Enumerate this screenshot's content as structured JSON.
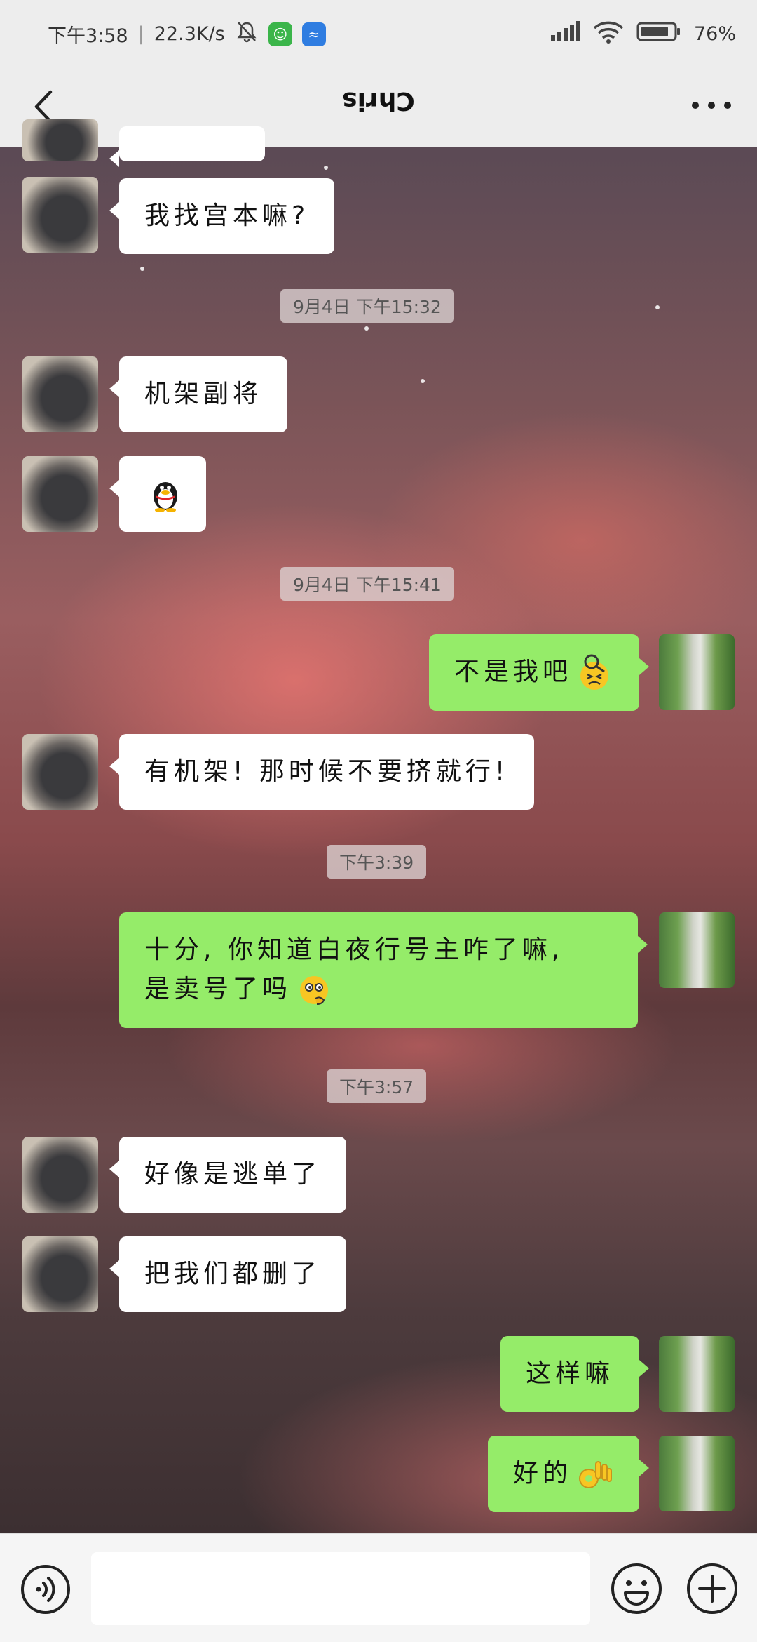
{
  "status_bar": {
    "time": "下午3:58",
    "speed": "22.3K/s",
    "battery": "76%"
  },
  "header": {
    "title": "Chris"
  },
  "messages": [
    {
      "side": "in",
      "text": "我找宫本嘛?"
    },
    {
      "type": "timestamp",
      "text": "9月4日 下午15:32"
    },
    {
      "side": "in",
      "text": "机架副将"
    },
    {
      "side": "in",
      "emoji": "qq-penguin-icon"
    },
    {
      "type": "timestamp",
      "text": "9月4日 下午15:41"
    },
    {
      "side": "out",
      "text": "不是我吧",
      "emoji": "embarrassed-emoji-icon"
    },
    {
      "side": "in",
      "text": "有机架! 那时候不要挤就行!"
    },
    {
      "type": "timestamp",
      "text": "下午3:39"
    },
    {
      "side": "out",
      "text": "十分, 你知道白夜行号主咋了嘛,",
      "text2": "是卖号了吗",
      "emoji": "thinking-emoji-icon"
    },
    {
      "type": "timestamp",
      "text": "下午3:57"
    },
    {
      "side": "in",
      "text": "好像是逃单了"
    },
    {
      "side": "in",
      "text": "把我们都删了"
    },
    {
      "side": "out",
      "text": "这样嘛"
    },
    {
      "side": "out",
      "text": "好的",
      "emoji": "ok-hand-emoji-icon"
    }
  ],
  "input": {
    "value": "",
    "placeholder": ""
  },
  "colors": {
    "bubble_out": "#95ec69",
    "bubble_in": "#ffffff",
    "bar_bg": "#ededed"
  }
}
